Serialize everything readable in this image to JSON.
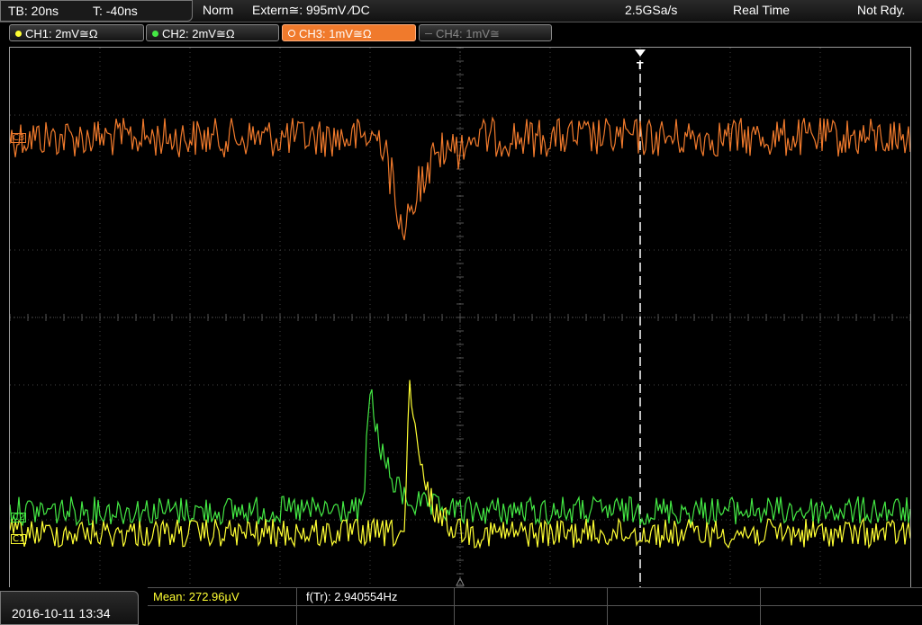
{
  "topbar": {
    "timebase": "TB: 20ns",
    "trigger_offset": "T: -40ns",
    "mode": "Norm",
    "trigger_source": "Extern≅: 995mV ⁄DC",
    "sample_rate": "2.5GSa/s",
    "acquisition": "Real Time",
    "status": "Not Rdy."
  },
  "channels": [
    {
      "label": "CH1: 2mV≅Ω",
      "color": "#ffff33"
    },
    {
      "label": "CH2: 2mV≅Ω",
      "color": "#44e844"
    },
    {
      "label": "CH3: 1mV≅Ω",
      "color": "#f07a2c"
    },
    {
      "label": "CH4: 1mV≅",
      "color": "#777777"
    }
  ],
  "markers": {
    "trigger": "T",
    "ch3": "C3",
    "ch2": "C2",
    "ch1": "C1"
  },
  "bottom": {
    "datetime": "2016-10-11 13:34",
    "mean": "Mean: 272.96µV",
    "freq": "f(Tr): 2.940554Hz"
  },
  "colors": {
    "grid": "#444444",
    "ch1": "#ffff33",
    "ch2": "#44e844",
    "ch3": "#f07a2c"
  }
}
